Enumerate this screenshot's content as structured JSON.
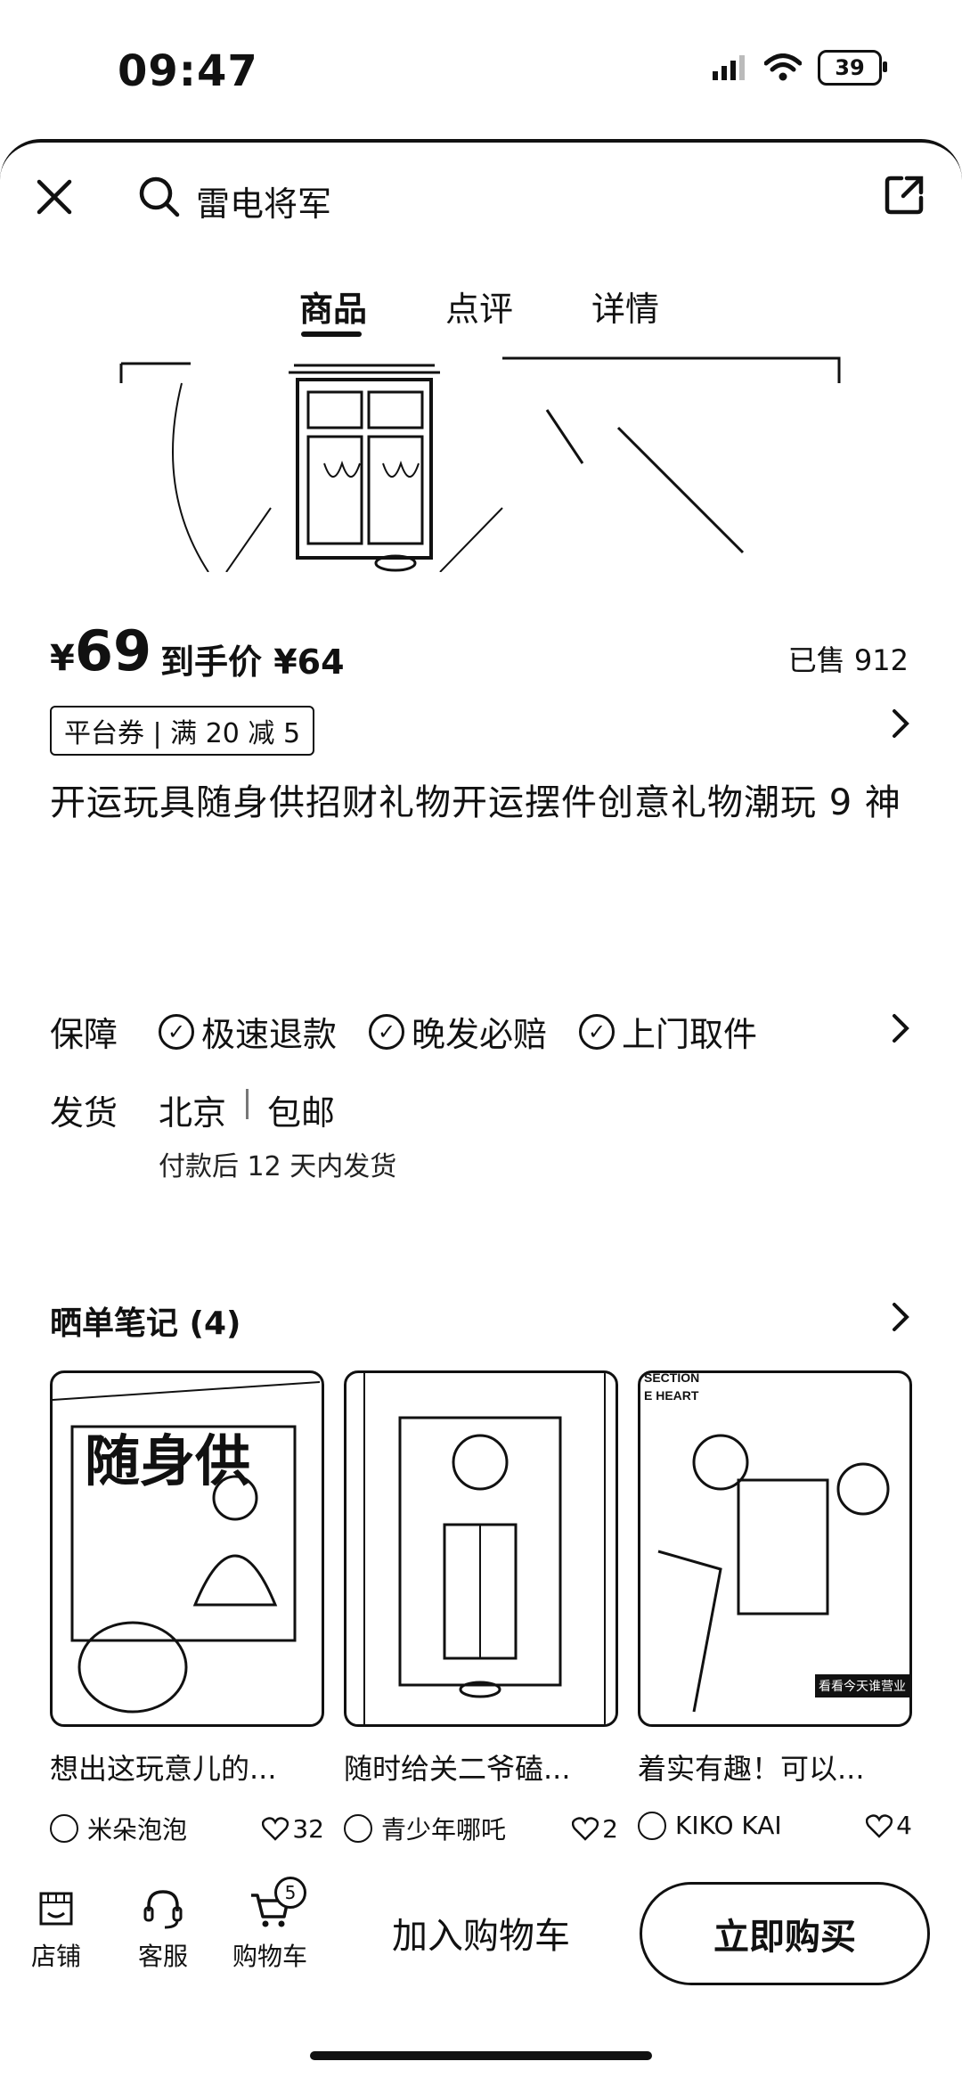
{
  "status_bar": {
    "time": "09:47",
    "battery": "39"
  },
  "search": {
    "query": "雷电将军"
  },
  "tabs": [
    {
      "label": "商品"
    },
    {
      "label": "点评"
    },
    {
      "label": "详情"
    }
  ],
  "product": {
    "price_symbol": "¥",
    "price": "69",
    "final_price": "到手价 ¥64",
    "sold": "已售 912",
    "coupon": "平台券 | 满 20 减 5",
    "title": "开运玩具随身供招财礼物开运摆件创意礼物潮玩 9 神"
  },
  "guarantee": {
    "label": "保障",
    "items": [
      "极速退款",
      "晚发必赔",
      "上门取件"
    ]
  },
  "shipping": {
    "label": "发货",
    "city": "北京",
    "free": "包邮",
    "note": "付款后 12 天内发货"
  },
  "notes": {
    "title": "晒单笔记 (4)",
    "items": [
      {
        "text": "想出这玩意儿的...",
        "author": "米朵泡泡",
        "likes": "32"
      },
      {
        "text": "随时给关二爷磕...",
        "author": "青少年哪吒",
        "likes": "2"
      },
      {
        "text": "着实有趣！可以...",
        "author": "KIKO KAI",
        "likes": "4"
      }
    ],
    "card1_image_text": "随身供",
    "card3_image_text_top": "SECTION",
    "card3_image_text_mid": "E HEART",
    "card3_image_tag": "看看今天谁营业"
  },
  "bottom_bar": {
    "shop": "店铺",
    "service": "客服",
    "cart": "购物车",
    "cart_count": "5",
    "add_to_cart": "加入购物车",
    "buy_now": "立即购买"
  }
}
